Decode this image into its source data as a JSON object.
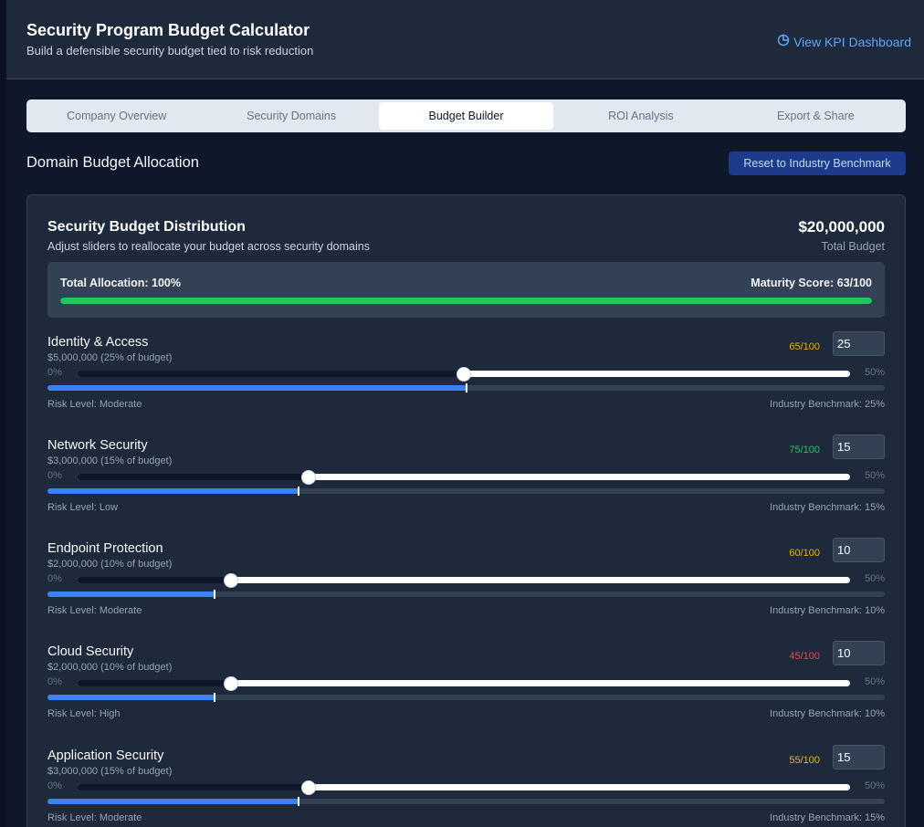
{
  "header": {
    "title": "Security Program Budget Calculator",
    "subtitle": "Build a defensible security budget tied to risk reduction",
    "kpi_link": "View KPI Dashboard",
    "kpi_icon": "pie-chart-icon"
  },
  "tabs": [
    {
      "label": "Company Overview",
      "active": false
    },
    {
      "label": "Security Domains",
      "active": false
    },
    {
      "label": "Budget Builder",
      "active": true
    },
    {
      "label": "ROI Analysis",
      "active": false
    },
    {
      "label": "Export & Share",
      "active": false
    }
  ],
  "section": {
    "title": "Domain Budget Allocation",
    "reset_label": "Reset to Industry Benchmark"
  },
  "card": {
    "title": "Security Budget Distribution",
    "subtitle": "Adjust sliders to reallocate your budget across security domains",
    "total_amount": "$20,000,000",
    "total_label": "Total Budget",
    "allocation_label": "Total Allocation: 100%",
    "allocation_percent": 100,
    "maturity_label": "Maturity Score: 63/100"
  },
  "slider_range": {
    "min_label": "0%",
    "max_label": "50%",
    "max": 50
  },
  "domains": [
    {
      "name": "Identity & Access",
      "amount": "$5,000,000 (25% of budget)",
      "score": "65/100",
      "score_color": "#eab308",
      "value": 25,
      "benchmark": 25,
      "risk": "Risk Level: Moderate",
      "benchmark_label": "Industry Benchmark: 25%"
    },
    {
      "name": "Network Security",
      "amount": "$3,000,000 (15% of budget)",
      "score": "75/100",
      "score_color": "#22c55e",
      "value": 15,
      "benchmark": 15,
      "risk": "Risk Level: Low",
      "benchmark_label": "Industry Benchmark: 15%"
    },
    {
      "name": "Endpoint Protection",
      "amount": "$2,000,000 (10% of budget)",
      "score": "60/100",
      "score_color": "#eab308",
      "value": 10,
      "benchmark": 10,
      "risk": "Risk Level: Moderate",
      "benchmark_label": "Industry Benchmark: 10%"
    },
    {
      "name": "Cloud Security",
      "amount": "$2,000,000 (10% of budget)",
      "score": "45/100",
      "score_color": "#ef4444",
      "value": 10,
      "benchmark": 10,
      "risk": "Risk Level: High",
      "benchmark_label": "Industry Benchmark: 10%"
    },
    {
      "name": "Application Security",
      "amount": "$3,000,000 (15% of budget)",
      "score": "55/100",
      "score_color": "#eab308",
      "value": 15,
      "benchmark": 15,
      "risk": "Risk Level: Moderate",
      "benchmark_label": "Industry Benchmark: 15%"
    }
  ]
}
